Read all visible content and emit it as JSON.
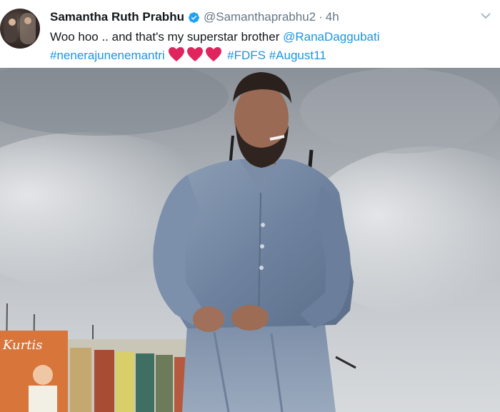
{
  "tweet": {
    "author_name": "Samantha Ruth Prabhu",
    "handle": "@Samanthaprabhu2",
    "separator": "·",
    "time": "4h",
    "text_line1": "Woo hoo .. and that's my superstar brother ",
    "mention": "@RanaDaggubati",
    "hashtag1": "#nenerajunenemantri",
    "hashtag2": "#FDFS",
    "hashtag3": "#August11",
    "heart_count": 3,
    "icons": {
      "verified": "verified-badge-icon",
      "chevron": "chevron-down-icon",
      "heart": "red-heart-icon"
    },
    "colors": {
      "link": "#1b95e0",
      "verified": "#1da1f2",
      "heart": "#e0245e"
    }
  },
  "media": {
    "billboard_text": "Kurtis",
    "description": ""
  }
}
